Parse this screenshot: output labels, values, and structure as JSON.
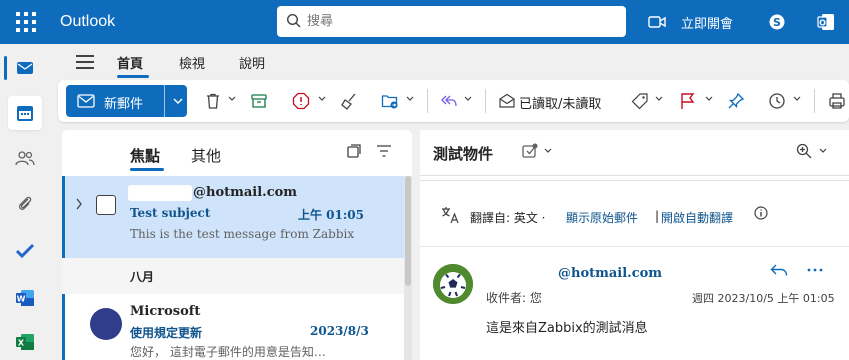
{
  "header": {
    "app_name": "Outlook",
    "search_placeholder": "搜尋",
    "meet_label": "立即開會"
  },
  "ribbon": {
    "tabs": [
      "首頁",
      "檢視",
      "說明"
    ],
    "new_mail_label": "新郵件",
    "read_unread_label": "已讀取/未讀取"
  },
  "mail_list": {
    "tabs": [
      "焦點",
      "其他"
    ],
    "selected": {
      "sender": "@hotmail.com",
      "subject": "Test subject",
      "time": "上午 01:05",
      "preview": "This is the test message from Zabbix"
    },
    "group_header": "八月",
    "second": {
      "sender": "Microsoft",
      "subject": "使用規定更新",
      "date": "2023/8/3",
      "preview": "您好， 這封電子郵件的用意是告知…"
    }
  },
  "reading": {
    "title": "測試物件",
    "translate_prefix": "翻譯自: 英文 ·",
    "show_original": "顯示原始郵件",
    "separator": "|",
    "auto_translate": "開啟自動翻譯",
    "from": "@hotmail.com",
    "to": "收件者: 您",
    "date": "週四 2023/10/5 上午 01:05",
    "body": "這是來自Zabbix的測試消息"
  },
  "colors": {
    "brand": "#0f6cbd",
    "selected_row": "#cfe4fa",
    "link": "#0f548c",
    "flag": "#c50f1f"
  }
}
